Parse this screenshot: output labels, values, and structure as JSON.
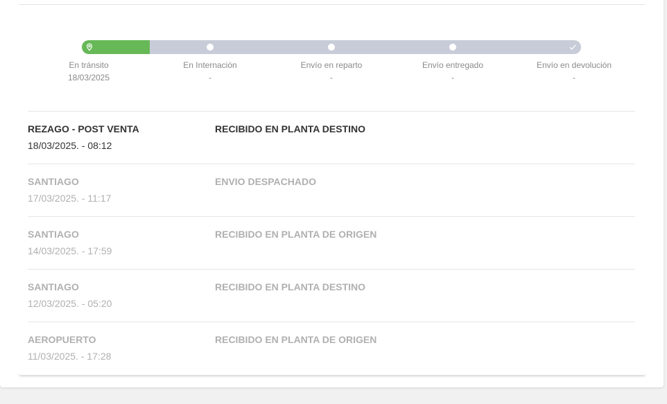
{
  "progress": {
    "fill_fraction": 0.136,
    "fill_color": "#67b857",
    "track_color": "#c7ccd8",
    "steps": [
      {
        "label": "En tránsito",
        "date": "18/03/2025",
        "icon": "location-pin-icon"
      },
      {
        "label": "En Internación",
        "date": "-",
        "icon": "dot-icon"
      },
      {
        "label": "Envío en reparto",
        "date": "-",
        "icon": "dot-icon"
      },
      {
        "label": "Envío entregado",
        "date": "-",
        "icon": "dot-icon"
      },
      {
        "label": "Envío en devolución",
        "date": "-",
        "icon": "check-icon"
      }
    ]
  },
  "events": [
    {
      "place": "REZAGO - POST VENTA",
      "datetime": "18/03/2025. - 08:12",
      "status": "RECIBIDO EN PLANTA DESTINO",
      "current": true
    },
    {
      "place": "SANTIAGO",
      "datetime": "17/03/2025. - 11:17",
      "status": "ENVIO DESPACHADO",
      "current": false
    },
    {
      "place": "SANTIAGO",
      "datetime": "14/03/2025. - 17:59",
      "status": "RECIBIDO EN PLANTA DE ORIGEN",
      "current": false
    },
    {
      "place": "SANTIAGO",
      "datetime": "12/03/2025. - 05:20",
      "status": "RECIBIDO EN PLANTA DESTINO",
      "current": false
    },
    {
      "place": "AEROPUERTO",
      "datetime": "11/03/2025. - 17:28",
      "status": "RECIBIDO EN PLANTA DE ORIGEN",
      "current": false
    }
  ]
}
